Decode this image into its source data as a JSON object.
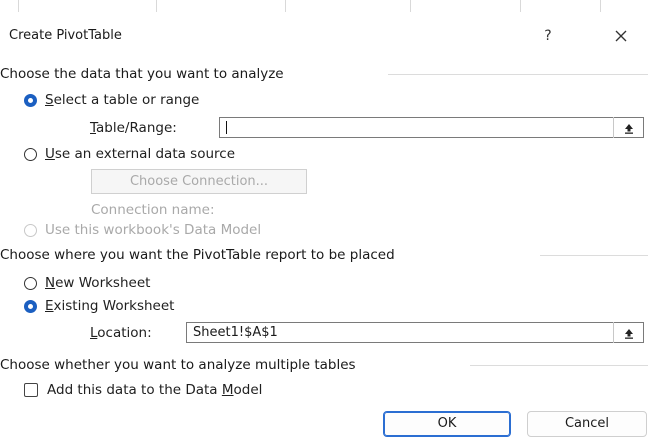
{
  "dialog": {
    "title": "Create PivotTable",
    "help_label": "?"
  },
  "analyze_section": {
    "heading": "Choose the data that you want to analyze",
    "select_range": {
      "label_pre": "",
      "label_ul": "S",
      "label_post": "elect a table or range",
      "selected": true
    },
    "table_range": {
      "label_ul": "T",
      "label_post": "able/Range:",
      "value": ""
    },
    "external": {
      "label_ul": "U",
      "label_post": "se an external data source",
      "selected": false
    },
    "choose_connection_label": "Choose Connection...",
    "connection_name_label": "Connection name:",
    "data_model_source": {
      "label": "Use this workbook's Data Model",
      "selected": false,
      "enabled": false
    }
  },
  "placement_section": {
    "heading": "Choose where you want the PivotTable report to be placed",
    "new_worksheet": {
      "label_ul": "N",
      "label_post": "ew Worksheet",
      "selected": false
    },
    "existing_worksheet": {
      "label_ul": "E",
      "label_post": "xisting Worksheet",
      "selected": true
    },
    "location": {
      "label_ul": "L",
      "label_post": "ocation:",
      "value": "Sheet1!$A$1"
    }
  },
  "multiple_section": {
    "heading": "Choose whether you want to analyze multiple tables",
    "add_to_model": {
      "label_pre": "Add this data to the Data ",
      "label_ul": "M",
      "label_post": "odel",
      "checked": false
    }
  },
  "buttons": {
    "ok": "OK",
    "cancel": "Cancel"
  }
}
